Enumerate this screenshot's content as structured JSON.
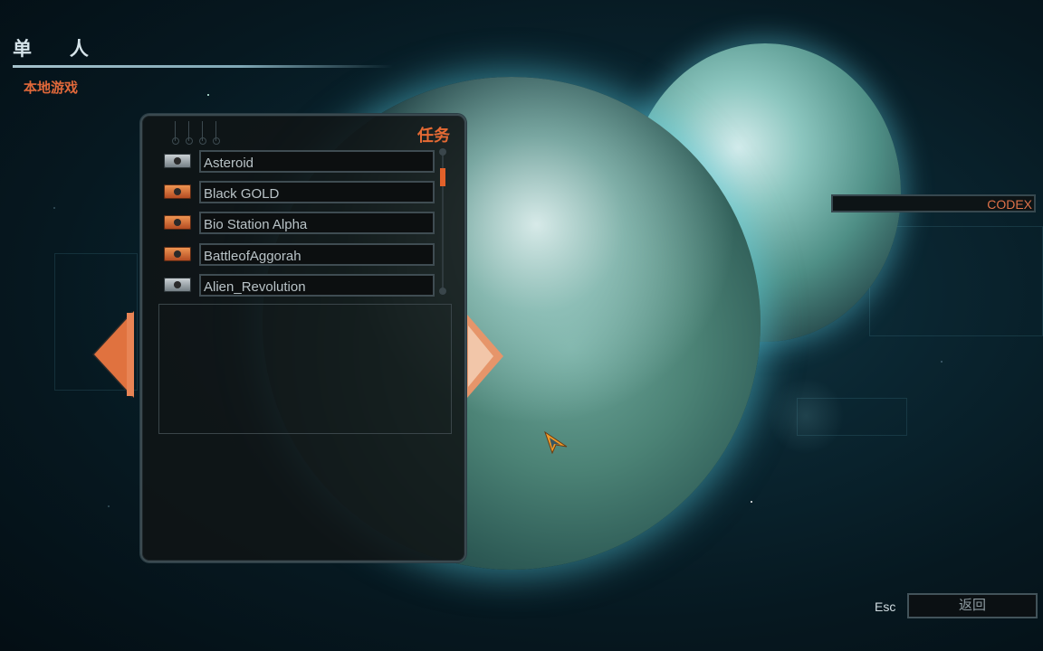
{
  "header": {
    "title": "单 人",
    "subtitle": "本地游戏"
  },
  "mission_panel": {
    "title": "任务",
    "missions": [
      {
        "name": "Asteroid",
        "badge": "silver-badge-icon"
      },
      {
        "name": "Black GOLD",
        "badge": "gold-badge-icon"
      },
      {
        "name": "Bio Station Alpha",
        "badge": "gold-badge-icon"
      },
      {
        "name": "BattleofAggorah",
        "badge": "gold-badge-icon"
      },
      {
        "name": "Alien_Revolution",
        "badge": "silver-badge-icon"
      }
    ]
  },
  "nav": {
    "prev_icon": "arrow-left-icon",
    "next_icon": "arrow-right-icon"
  },
  "codex": {
    "label": "CODEX"
  },
  "footer": {
    "esc_hint": "Esc",
    "back_label": "返回"
  },
  "colors": {
    "accent": "#e56a34",
    "text_light": "#b9c3c7"
  }
}
